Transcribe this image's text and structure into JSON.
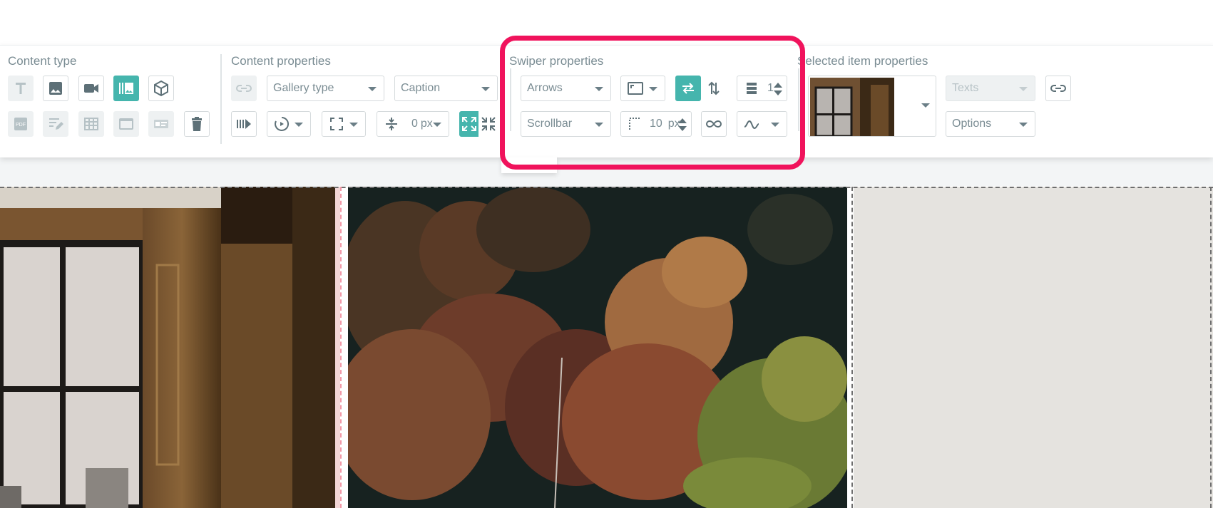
{
  "sections": {
    "content_type": "Content type",
    "content_properties": "Content properties",
    "swiper_properties": "Swiper properties",
    "selected_item_properties": "Selected item properties"
  },
  "content_properties": {
    "gallery_type": "Gallery type",
    "caption": "Caption",
    "spacing_value": "0",
    "spacing_unit": "px"
  },
  "swiper_properties": {
    "navigation": "Arrows",
    "pagination": "Scrollbar",
    "slides_per_view": "1",
    "space_value": "10",
    "space_unit": "px"
  },
  "selected_item": {
    "texts": "Texts",
    "options": "Options"
  },
  "colors": {
    "accent": "#45b5ad",
    "highlight": "#f0135c",
    "icon": "#6b7f87"
  }
}
